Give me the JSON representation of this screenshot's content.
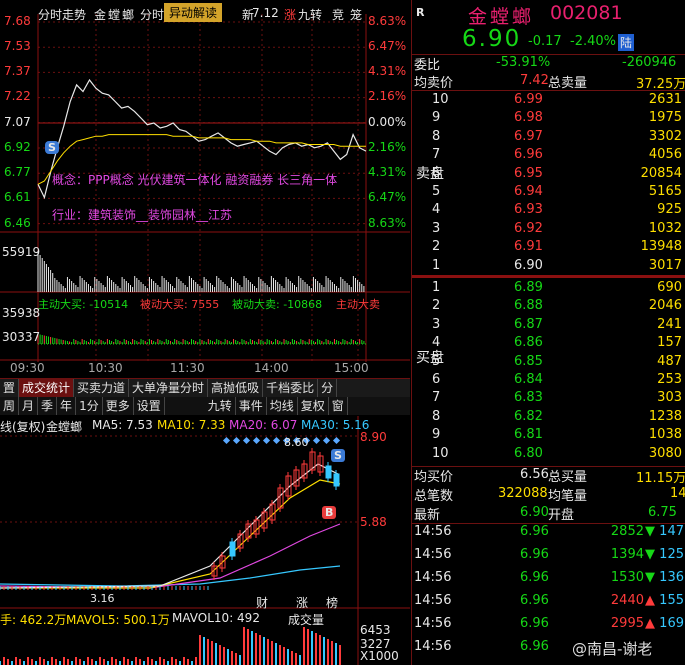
{
  "intraday": {
    "header": {
      "tab_label": "分时走势",
      "stock_name": "金螳螂",
      "tab2": "分时",
      "popup": "异动解读",
      "price_suffix": "新",
      "price": "7.12",
      "badge_up": "涨",
      "badge_nine": "九转",
      "badge_bid": "竞",
      "badge_more": "笼"
    },
    "price_axis_left": [
      "7.68",
      "7.53",
      "7.37",
      "7.22",
      "7.07",
      "6.92",
      "6.77",
      "6.61",
      "6.46"
    ],
    "pct_axis_right": [
      "8.63%",
      "6.47%",
      "4.31%",
      "2.16%",
      "0.00%",
      "2.16%",
      "4.31%",
      "6.47%",
      "8.63%"
    ],
    "concept_text": "概念：PPP概念  光伏建筑一体化  融资融券  长三角一体",
    "industry_text": "行业：建筑装饰__装饰园林__江苏",
    "volume_axis": "55919",
    "flow_labels": {
      "active_buy": "主动大买: -10514",
      "passive_buy": "被动大买: 7555",
      "passive_sell": "被动大卖: -10868",
      "active_sell": "主动大卖"
    },
    "flow_axis": [
      "35938",
      "30337"
    ],
    "time_labels": [
      "09:30",
      "10:30",
      "11:30",
      "14:00",
      "15:00"
    ],
    "marker_s": "S",
    "price_series": [
      6.7,
      6.62,
      6.78,
      6.92,
      7.05,
      7.2,
      7.3,
      7.26,
      7.33,
      7.28,
      7.25,
      7.24,
      7.2,
      7.16,
      7.17,
      7.14,
      7.1,
      7.06,
      7.07,
      7.04,
      7.05,
      7.07,
      7.03,
      7.02,
      6.99,
      6.96,
      6.97,
      6.99,
      7.01,
      6.98,
      6.95,
      6.93,
      6.94,
      6.95,
      6.96,
      6.93,
      6.9,
      6.88,
      6.92,
      6.94,
      6.95,
      6.93,
      6.94,
      6.92,
      6.93,
      6.95,
      6.9,
      6.85,
      6.88,
      7.0,
      6.92,
      6.9
    ],
    "avg_series": [
      6.7,
      6.72,
      6.78,
      6.84,
      6.89,
      6.93,
      6.96,
      6.97,
      6.98,
      6.99,
      6.99,
      7.0,
      7.0,
      7.0,
      7.0,
      7.0,
      7.0,
      7.0,
      7.0,
      7.0,
      7.0,
      6.99,
      6.99,
      6.99,
      6.99,
      6.98,
      6.98,
      6.98,
      6.98,
      6.98,
      6.97,
      6.97,
      6.97,
      6.97,
      6.96,
      6.96,
      6.96,
      6.95,
      6.95,
      6.95,
      6.95,
      6.95,
      6.94,
      6.94,
      6.94,
      6.94,
      6.94,
      6.93,
      6.93,
      6.93,
      6.93,
      6.93
    ]
  },
  "tabs1": [
    "置",
    "成交统计",
    "买卖力道",
    "大单净量分时",
    "高抛低吸",
    "千档委比",
    "分"
  ],
  "tabs2": [
    "周",
    "月",
    "季",
    "年",
    "1分",
    "更多",
    "设置",
    "九转",
    "事件",
    "均线",
    "复权",
    "窗"
  ],
  "kline": {
    "title": "线(复权)",
    "name": "金螳螂",
    "ma": [
      {
        "label": "MA5: 7.53",
        "color": "#e8e8e8"
      },
      {
        "label": "MA10: 7.33",
        "color": "#ffdf00"
      },
      {
        "label": "MA20: 6.07",
        "color": "#e048e0"
      },
      {
        "label": "MA30: 5.16",
        "color": "#36c8ff"
      }
    ],
    "high_label": "8.60",
    "axis": [
      "8.90",
      "5.88"
    ],
    "low_label": "3.16",
    "marker_s": "S",
    "marker_b": "B",
    "events": [
      "财",
      "涨",
      "榜"
    ],
    "vol_bar": {
      "label1": "手: 462.2万",
      "label2": "MAVOL5: 500.1万",
      "label3": "MAVOL10: 492",
      "tab": "成交量"
    },
    "vol_axis": [
      "6453",
      "3227",
      "X1000"
    ]
  },
  "quote": {
    "tag": "R",
    "name": "金螳螂",
    "code": "002081",
    "price": "6.90",
    "change": "-0.17",
    "pct": "-2.40%",
    "badge": "陆",
    "weibi_label": "委比",
    "weibi_pct": "-53.91%",
    "weibi_val": "-260946",
    "junmai_label": "均卖价",
    "junmai_val": "7.42",
    "zongmai_label": "总卖量",
    "zongmai_val": "37.25万",
    "sell_side": "卖盘",
    "buy_side": "买盘",
    "asks": [
      {
        "lv": "10",
        "p": "6.99",
        "v": "2631"
      },
      {
        "lv": "9",
        "p": "6.98",
        "v": "1975"
      },
      {
        "lv": "8",
        "p": "6.97",
        "v": "3302"
      },
      {
        "lv": "7",
        "p": "6.96",
        "v": "4056"
      },
      {
        "lv": "6",
        "p": "6.95",
        "v": "20854"
      },
      {
        "lv": "5",
        "p": "6.94",
        "v": "5165"
      },
      {
        "lv": "4",
        "p": "6.93",
        "v": "925"
      },
      {
        "lv": "3",
        "p": "6.92",
        "v": "1032"
      },
      {
        "lv": "2",
        "p": "6.91",
        "v": "13948"
      },
      {
        "lv": "1",
        "p": "6.90",
        "v": "3017"
      }
    ],
    "bids": [
      {
        "lv": "1",
        "p": "6.89",
        "v": "690"
      },
      {
        "lv": "2",
        "p": "6.88",
        "v": "2046"
      },
      {
        "lv": "3",
        "p": "6.87",
        "v": "241"
      },
      {
        "lv": "4",
        "p": "6.86",
        "v": "157"
      },
      {
        "lv": "5",
        "p": "6.85",
        "v": "487"
      },
      {
        "lv": "6",
        "p": "6.84",
        "v": "253"
      },
      {
        "lv": "7",
        "p": "6.83",
        "v": "303"
      },
      {
        "lv": "8",
        "p": "6.82",
        "v": "1238"
      },
      {
        "lv": "9",
        "p": "6.81",
        "v": "1038"
      },
      {
        "lv": "10",
        "p": "6.80",
        "v": "3080"
      }
    ],
    "junmai2_label": "均买价",
    "junmai2_val": "6.56",
    "zongmai2_label": "总买量",
    "zongmai2_val": "11.15万",
    "zongbi_label": "总笔数",
    "zongbi_val": "322088",
    "junbi_label": "均笔量",
    "junbi_val": "14",
    "zuixin_label": "最新",
    "zuixin_val": "6.90",
    "kaipan_label": "开盘",
    "kaipan_val": "6.75",
    "ticks": [
      {
        "t": "14:56",
        "p": "6.96",
        "v": "2852",
        "dir": "down",
        "n": "147"
      },
      {
        "t": "14:56",
        "p": "6.96",
        "v": "1394",
        "dir": "down",
        "n": "125"
      },
      {
        "t": "14:56",
        "p": "6.96",
        "v": "1530",
        "dir": "down",
        "n": "136"
      },
      {
        "t": "14:56",
        "p": "6.96",
        "v": "2440",
        "dir": "up",
        "n": "155"
      },
      {
        "t": "14:56",
        "p": "6.96",
        "v": "2995",
        "dir": "up",
        "n": "169"
      },
      {
        "t": "14:56",
        "p": "6.96",
        "v": "",
        "dir": "",
        "n": ""
      }
    ],
    "watermark": "@南昌-谢老"
  }
}
